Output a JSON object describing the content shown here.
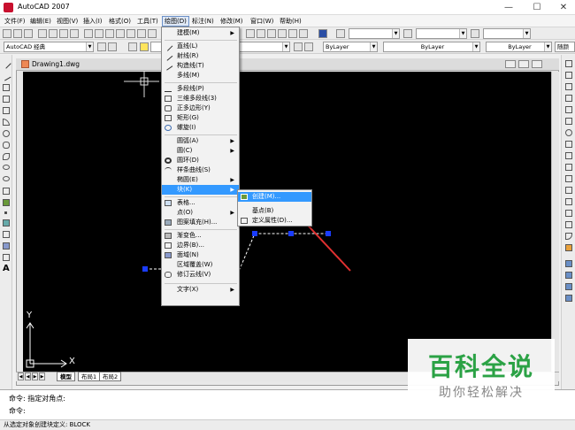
{
  "window": {
    "title": "AutoCAD 2007",
    "minimize": "—",
    "maximize": "☐",
    "close": "✕"
  },
  "menubar": [
    "文件(F)",
    "编辑(E)",
    "视图(V)",
    "插入(I)",
    "格式(O)",
    "工具(T)",
    "绘图(D)",
    "标注(N)",
    "修改(M)",
    "窗口(W)",
    "帮助(H)"
  ],
  "toolbar": {
    "workspace": "AutoCAD 经典",
    "layer_linetype": "ByLayer",
    "layer_lineweight": "ByLayer",
    "layer_color": "ByLayer",
    "right_label": "随颜"
  },
  "document": {
    "title": "Drawing1.dwg",
    "tabs": [
      "模型",
      "布局1",
      "布局2"
    ],
    "axis_x": "X",
    "axis_y": "Y"
  },
  "draw_menu": {
    "items": [
      {
        "label": "建模(M)",
        "submenu": true
      },
      {
        "label": "直线(L)"
      },
      {
        "label": "射线(R)"
      },
      {
        "label": "构造线(T)"
      },
      {
        "label": "多线(M)"
      },
      {
        "label": "多段线(P)"
      },
      {
        "label": "三维多段线(3)"
      },
      {
        "label": "正多边形(Y)"
      },
      {
        "label": "矩形(G)"
      },
      {
        "label": "螺旋(I)"
      },
      {
        "label": "圆弧(A)",
        "submenu": true
      },
      {
        "label": "圆(C)",
        "submenu": true
      },
      {
        "label": "圆环(D)"
      },
      {
        "label": "样条曲线(S)"
      },
      {
        "label": "椭圆(E)",
        "submenu": true
      },
      {
        "label": "块(K)",
        "submenu": true,
        "highlighted": true
      },
      {
        "label": "表格..."
      },
      {
        "label": "点(O)",
        "submenu": true
      },
      {
        "label": "图案填充(H)..."
      },
      {
        "label": "渐变色..."
      },
      {
        "label": "边界(B)..."
      },
      {
        "label": "面域(N)"
      },
      {
        "label": "区域覆盖(W)"
      },
      {
        "label": "修订云线(V)"
      },
      {
        "label": "文字(X)",
        "submenu": true
      }
    ]
  },
  "block_submenu": {
    "items": [
      {
        "label": "创建(M)...",
        "highlighted": true
      },
      {
        "label": "基点(B)"
      },
      {
        "label": "定义属性(D)..."
      }
    ]
  },
  "command": {
    "line1": "命令: 指定对角点:",
    "line2": "命令:"
  },
  "status": {
    "text": "从选定对象创建块定义:   BLOCK"
  },
  "watermark": {
    "title": "百科全说",
    "subtitle": "助你轻松解决"
  },
  "colors": {
    "canvas": "#000000",
    "highlight": "#3399ff",
    "arrow": "#e03030",
    "grip": "#1a3cff",
    "watermark_green": "#2ba245"
  }
}
